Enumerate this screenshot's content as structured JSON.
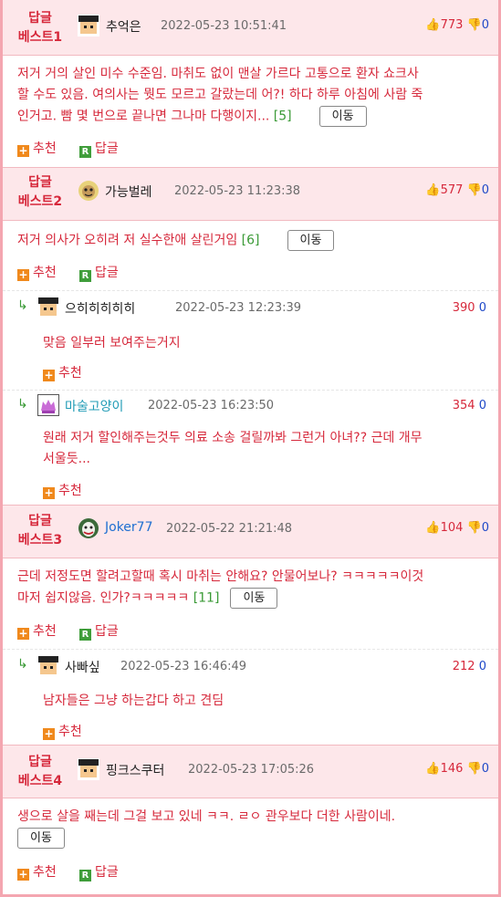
{
  "ui": {
    "move_label": "이동",
    "recommend_label": "추천",
    "reply_label": "답글"
  },
  "comments": [
    {
      "best": [
        "답글",
        "베스트1"
      ],
      "author": "추억은",
      "date": "2022-05-23 10:51:41",
      "up": "773",
      "down": "0",
      "lines": [
        "저거 거의 살인 미수 수준임. 마취도 없이 맨살 가르다 고통으로 환자 쇼크사",
        "할 수도 있음. 여의사는 뭣도 모르고 갈랐는데 어?! 하다 하루 아침에 사람 죽",
        "인거고. 빰 몇 번으로 끝나면 그나마 다행이지..."
      ],
      "count": "[5]",
      "replies": []
    },
    {
      "best": [
        "답글",
        "베스트2"
      ],
      "author": "가능벌레",
      "date": "2022-05-23 11:23:38",
      "up": "577",
      "down": "0",
      "lines": [
        "저거 의사가 오히려 저 실수한애 살린거임"
      ],
      "count": "[6]",
      "replies": [
        {
          "author": "으히히히히히",
          "date": "2022-05-23 12:23:39",
          "up": "390",
          "down": "0",
          "lines": [
            "맞음 일부러 보여주는거지"
          ]
        },
        {
          "author": "마술고양이",
          "date": "2022-05-23 16:23:50",
          "up": "354",
          "down": "0",
          "lines": [
            "원래 저거 할인해주는것두 의료 소송 걸릴까봐 그런거 아녀?? 근데 개무",
            "서울듯..."
          ]
        }
      ]
    },
    {
      "best": [
        "답글",
        "베스트3"
      ],
      "author": "Joker77",
      "date": "2022-05-22 21:21:48",
      "up": "104",
      "down": "0",
      "lines": [
        "근데 저정도면 할려고할때 혹시 마취는 안해요? 안물어보나? ㅋㅋㅋㅋㅋ이것",
        "마저 쉽지않음. 인가?ㅋㅋㅋㅋㅋ"
      ],
      "count": "[11]",
      "replies": [
        {
          "author": "사빠싶",
          "date": "2022-05-23 16:46:49",
          "up": "212",
          "down": "0",
          "lines": [
            "남자들은 그냥 하는갑다 하고 견딤"
          ]
        }
      ]
    },
    {
      "best": [
        "답글",
        "베스트4"
      ],
      "author": "핑크스쿠터",
      "date": "2022-05-23 17:05:26",
      "up": "146",
      "down": "0",
      "lines": [
        "생으로 살을 째는데 그걸 보고 있네 ㅋㅋ. ㄹㅇ 관우보다 더한 사람이네."
      ],
      "count": "",
      "replies": []
    }
  ]
}
